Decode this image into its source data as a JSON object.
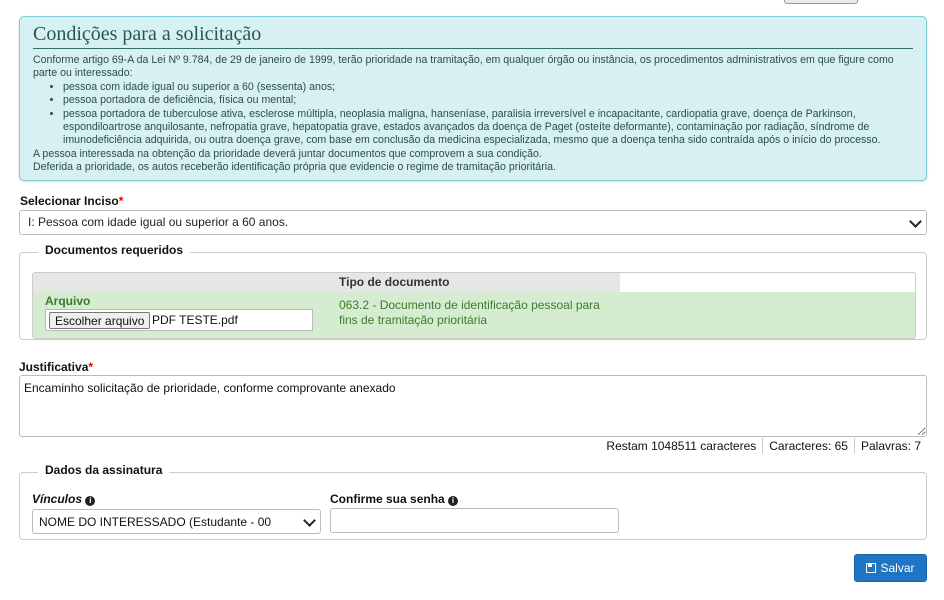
{
  "conditions": {
    "title": "Condições para a solicitação",
    "intro": "Conforme artigo 69-A da Lei Nº 9.784, de 29 de janeiro de 1999, terão prioridade na tramitação, em qualquer órgão ou instância, os procedimentos administrativos em que figure como parte ou interessado:",
    "items": [
      "pessoa com idade igual ou superior a 60 (sessenta) anos;",
      "pessoa portadora de deficiência, física ou mental;",
      "pessoa portadora de tuberculose ativa, esclerose múltipla, neoplasia maligna, hanseníase, paralisia irreversível e incapacitante, cardiopatia grave, doença de Parkinson, espondiloartrose anquilosante, nefropatia grave, hepatopatia grave, estados avançados da doença de Paget (osteíte deformante), contaminação por radiação, síndrome de imunodeficiência adquirida, ou outra doença grave, com base em conclusão da medicina especializada, mesmo que a doença tenha sido contraída após o início do processo."
    ],
    "note1": "A pessoa interessada na obtenção da prioridade deverá juntar documentos que comprovem a sua condição.",
    "note2": "Deferida a prioridade, os autos receberão identificação própria que evidencie o regime de tramitação prioritária."
  },
  "inciso": {
    "label": "Selecionar Inciso",
    "required_mark": "*",
    "selected": "I: Pessoa com idade igual ou superior a 60 anos."
  },
  "documents": {
    "legend": "Documentos requeridos",
    "column_header": "Tipo de documento",
    "file_label": "Arquivo",
    "file_button": "Escolher arquivo",
    "file_name": "PDF TESTE.pdf",
    "doc_type": "063.2 - Documento de identificação pessoal para fins de tramitação prioritária"
  },
  "justification": {
    "label": "Justificativa",
    "required_mark": "*",
    "value": "Encaminho solicitação de prioridade, conforme comprovante anexado",
    "remaining": "Restam 1048511 caracteres",
    "characters": "Caracteres: 65",
    "words": "Palavras: 7"
  },
  "signature": {
    "legend": "Dados da assinatura",
    "vinculos_label": "Vínculos",
    "vinculos_selected": "NOME DO INTERESSADO (Estudante - 00",
    "password_label": "Confirme sua senha",
    "info_icon": "info-circle-icon"
  },
  "actions": {
    "save_label": "Salvar",
    "save_icon": "floppy-disk-icon",
    "primary_color": "#1f75c4"
  }
}
